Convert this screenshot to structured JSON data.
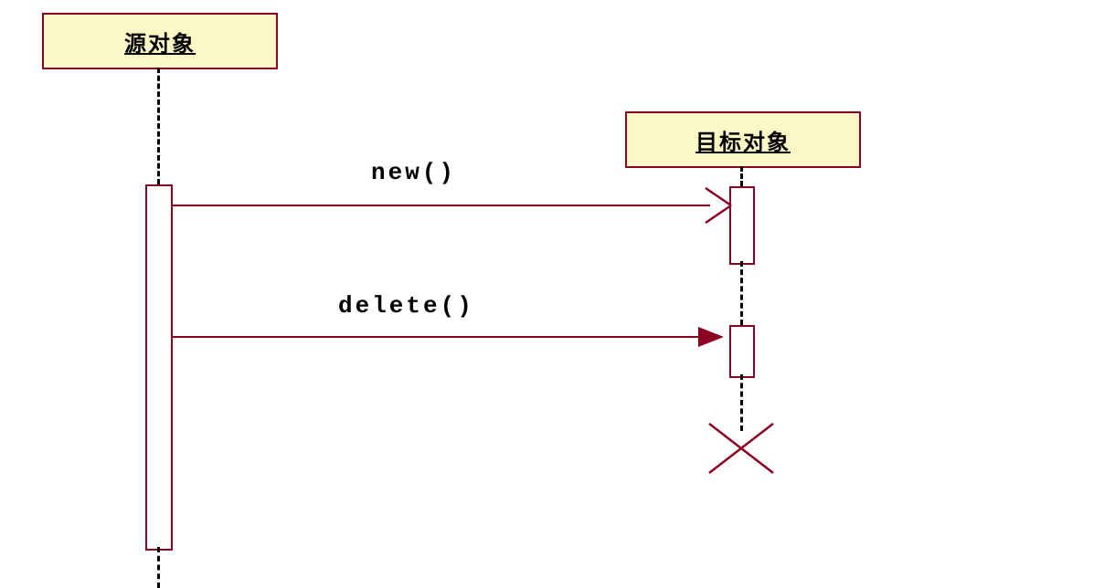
{
  "diagram": {
    "type": "sequence",
    "source_object_label": "源对象",
    "target_object_label": "目标对象",
    "messages": {
      "create_label": "new()",
      "delete_label": "delete()"
    }
  }
}
